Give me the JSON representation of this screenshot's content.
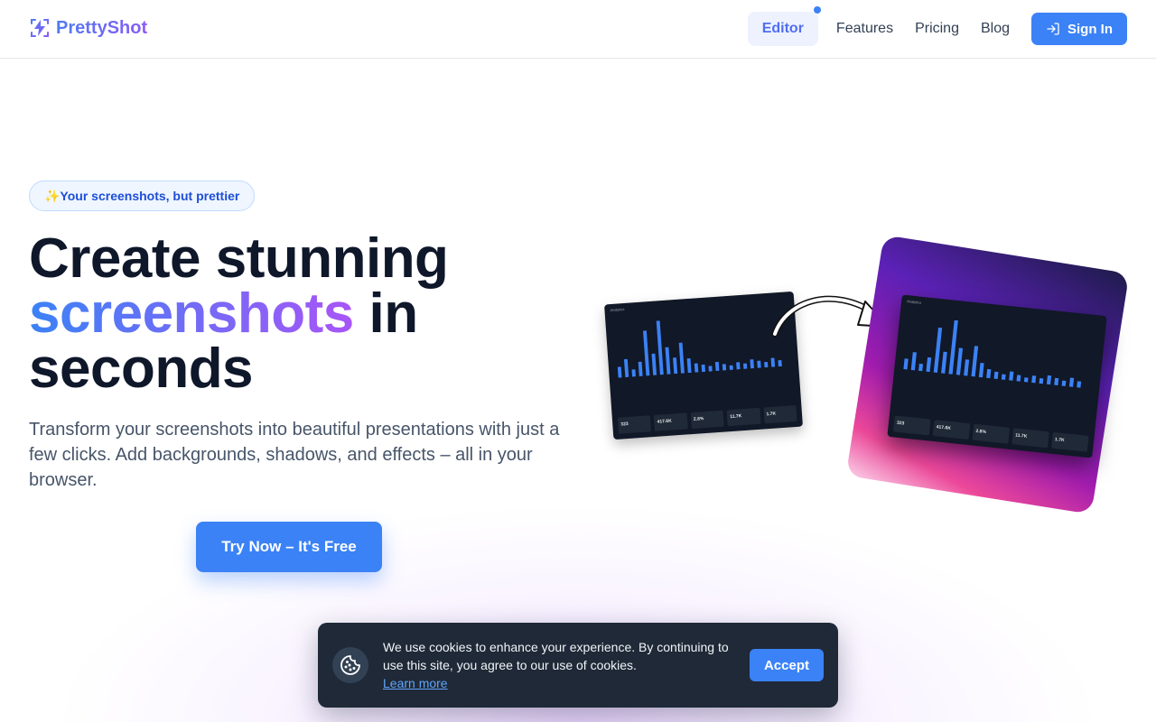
{
  "brand": {
    "name": "PrettyShot"
  },
  "nav": {
    "items": [
      {
        "label": "Editor"
      },
      {
        "label": "Features"
      },
      {
        "label": "Pricing"
      },
      {
        "label": "Blog"
      }
    ],
    "signin_label": "Sign In"
  },
  "hero": {
    "badge": "✨Your screenshots, but prettier",
    "headline_line1": "Create stunning",
    "headline_highlight": "screenshots",
    "headline_after": " in",
    "headline_line3": "seconds",
    "subtext": "Transform your screenshots into beautiful presentations with just a few clicks. Add backgrounds, shadows, and effects – all in your browser.",
    "cta_label": "Try Now – It's Free"
  },
  "preview": {
    "screenshot_title": "Analytics",
    "stats": [
      "323",
      "417.6K",
      "2.8%",
      "11.7K",
      "1.7K"
    ]
  },
  "cookie": {
    "message": "We use cookies to enhance your experience. By continuing to use this site, you agree to our use of cookies.",
    "learn_more": "Learn more",
    "accept_label": "Accept"
  },
  "colors": {
    "accent": "#3b82f6",
    "brand_gradient_start": "#4f7cf2",
    "brand_gradient_end": "#8b5cf6",
    "cookie_bg": "#1f2937"
  }
}
